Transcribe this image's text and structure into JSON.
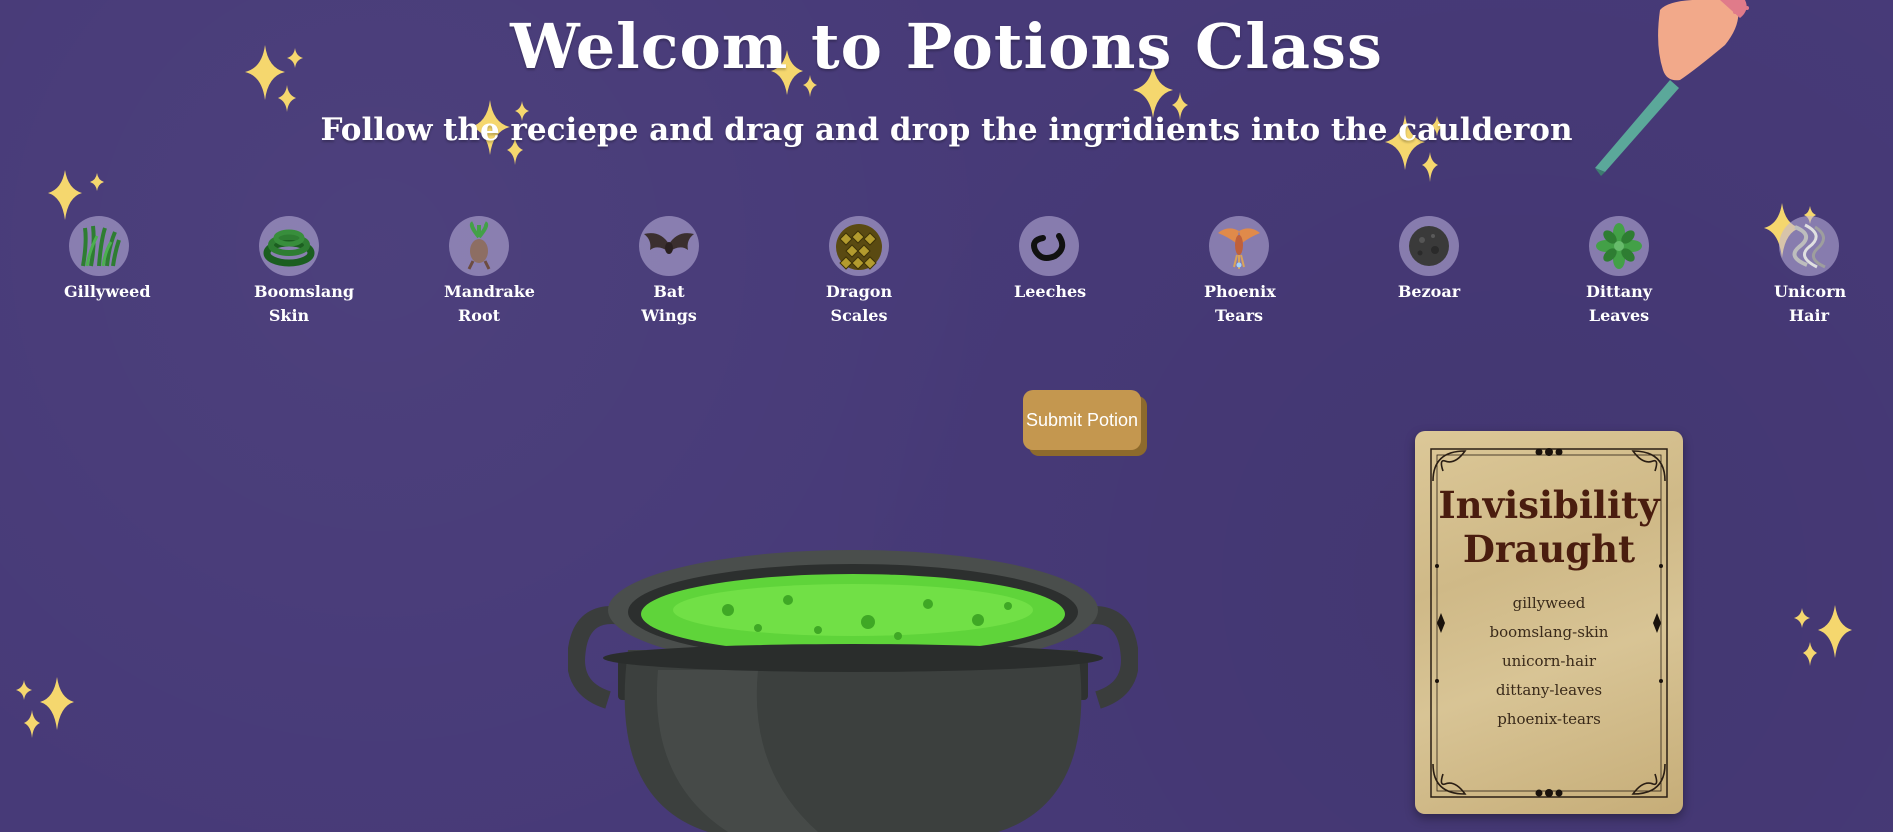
{
  "header": {
    "title": "Welcom to Potions Class",
    "subtitle": "Follow the reciepe and drag and drop the ingridients into the caulderon"
  },
  "ingredients": [
    {
      "label": "Gillyweed",
      "icon": "gillyweed-icon",
      "color": "#2e7d32"
    },
    {
      "label": "Boomslang Skin",
      "icon": "snake-icon",
      "color": "#1b5e20"
    },
    {
      "label": "Mandrake Root",
      "icon": "mandrake-icon",
      "color": "#8d6e63"
    },
    {
      "label": "Bat Wings",
      "icon": "bat-icon",
      "color": "#3b2f2f"
    },
    {
      "label": "Dragon Scales",
      "icon": "dragon-scales-icon",
      "color": "#7a6a1f"
    },
    {
      "label": "Leeches",
      "icon": "leech-icon",
      "color": "#1a1a1a"
    },
    {
      "label": "Phoenix Tears",
      "icon": "phoenix-icon",
      "color": "#c98b4a"
    },
    {
      "label": "Bezoar",
      "icon": "bezoar-icon",
      "color": "#444444"
    },
    {
      "label": "Dittany Leaves",
      "icon": "dittany-icon",
      "color": "#43a047"
    },
    {
      "label": "Unicorn Hair",
      "icon": "unicorn-hair-icon",
      "color": "#9e9e9e"
    }
  ],
  "submit_button": {
    "label": "Submit Potion"
  },
  "recipe_card": {
    "title": "Invisibility Draught",
    "items": [
      "gillyweed",
      "boomslang-skin",
      "unicorn-hair",
      "dittany-leaves",
      "phoenix-tears"
    ]
  },
  "colors": {
    "background": "#473a78",
    "button": "#c4974f",
    "button_shadow": "#8d6a2c",
    "parchment": "#d4bf8f",
    "potion": "#5fd43a",
    "sparkle": "#f5d76e"
  }
}
